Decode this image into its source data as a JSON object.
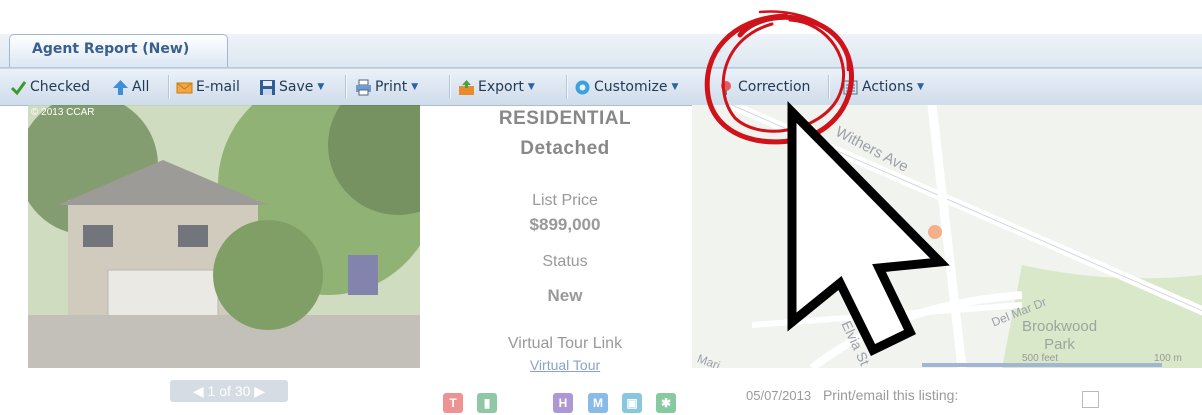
{
  "tab": {
    "label": "Agent Report (New)"
  },
  "toolbar": {
    "checked": "Checked",
    "all": "All",
    "email": "E-mail",
    "save": "Save",
    "print": "Print",
    "export": "Export",
    "customize": "Customize",
    "correction": "Correction",
    "actions": "Actions"
  },
  "photo": {
    "watermark": "© 2013 CCAR",
    "counter": "◀ 1 of 30 ▶"
  },
  "listing": {
    "type": "RESIDENTIAL",
    "subtype": "Detached",
    "list_price_label": "List Price",
    "list_price": "$899,000",
    "status_label": "Status",
    "status": "New",
    "virtual_tour_label": "Virtual Tour Link",
    "virtual_tour_link": "Virtual Tour"
  },
  "badges": {
    "t": "T",
    "h": "H",
    "m": "M"
  },
  "map": {
    "street1": "Withers Ave",
    "street2": "Del Mar Dr",
    "street3": "Elvia St",
    "street4": "Mari",
    "park": "Brookwood\nPark",
    "scale_ft": "500 feet",
    "scale_m": "100 m"
  },
  "footer": {
    "date": "05/07/2013",
    "print_email": "Print/email this listing:"
  },
  "colors": {
    "toolbar_text": "#223a57",
    "tab_text": "#3a5f8c",
    "annotation_red": "#d0121a"
  }
}
